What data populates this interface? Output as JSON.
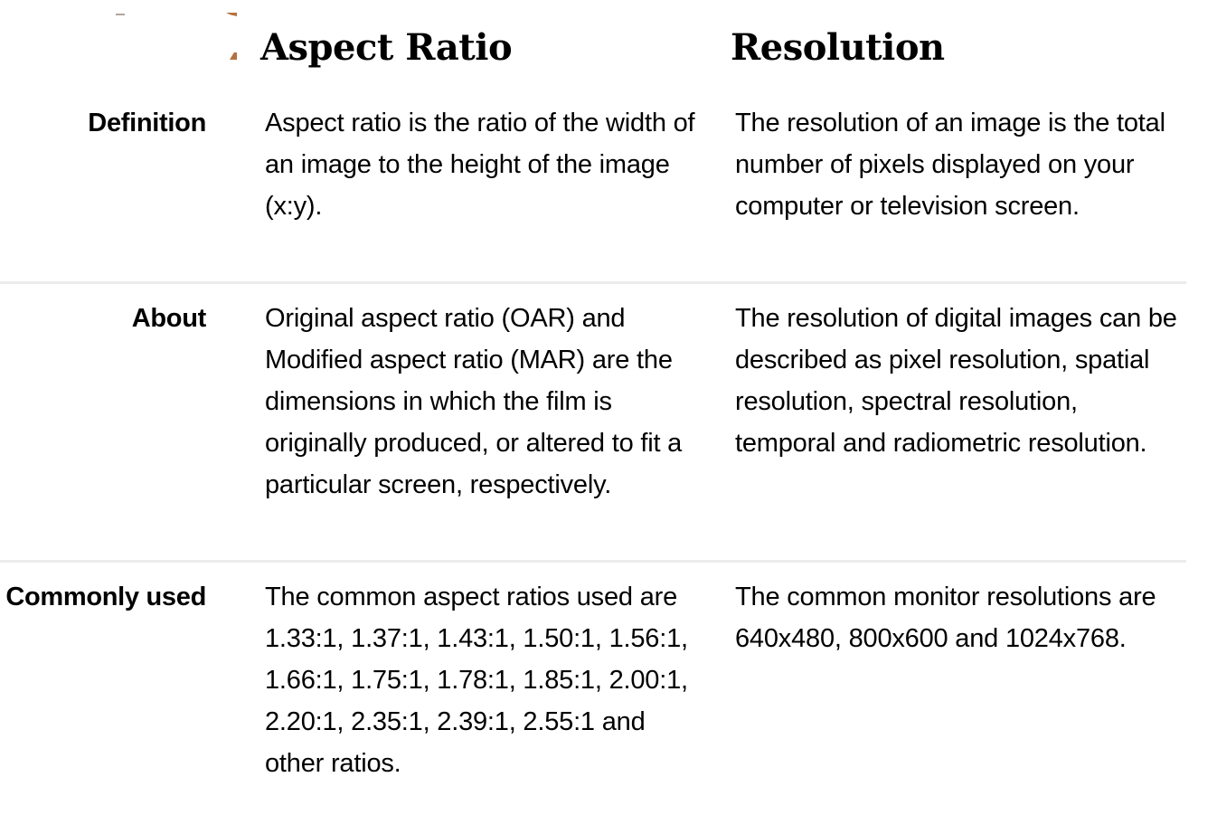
{
  "columns": {
    "aspect": "Aspect Ratio",
    "resolution": "Resolution"
  },
  "rows": [
    {
      "label": "Definition",
      "aspect": "Aspect ratio is the ratio of the width of an image to the height of the image (x:y).",
      "resolution": "The resolution of an image is the total number of pixels displayed on your computer or television screen."
    },
    {
      "label": "About",
      "aspect": "Original aspect ratio (OAR) and Modified aspect ratio (MAR) are the dimensions in which the film is originally produced, or altered to fit a particular screen, respectively.",
      "resolution": "The resolution of digital images can be described as pixel resolution, spatial resolution, spectral resolution, temporal and radiometric resolution."
    },
    {
      "label": "Commonly used",
      "aspect": "The common aspect ratios used are 1.33:1, 1.37:1, 1.43:1, 1.50:1, 1.56:1, 1.66:1, 1.75:1, 1.78:1, 1.85:1, 2.00:1, 2.20:1, 2.35:1, 2.39:1, 2.55:1 and other ratios.",
      "resolution": "The common monitor resolutions are 640x480, 800x600 and 1024x768."
    }
  ],
  "colors": {
    "text": "#000000",
    "divider": "#ececec",
    "background": "#ffffff"
  }
}
